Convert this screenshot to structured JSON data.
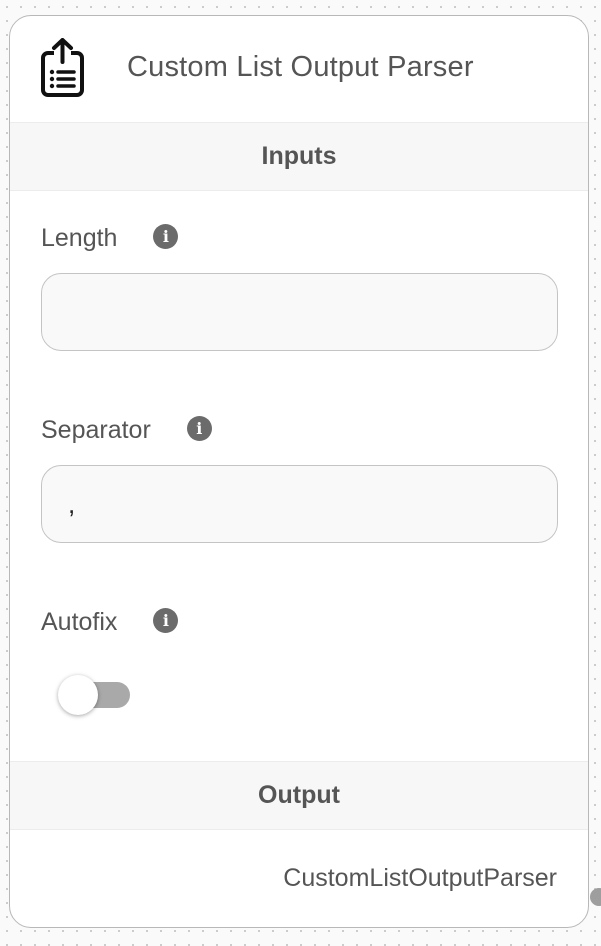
{
  "node": {
    "title": "Custom List Output Parser",
    "icon": "file-upload-list-icon"
  },
  "sections": {
    "inputs_label": "Inputs",
    "output_label": "Output"
  },
  "fields": {
    "length": {
      "label": "Length",
      "value": "",
      "placeholder": ""
    },
    "separator": {
      "label": "Separator",
      "value": ","
    },
    "autofix": {
      "label": "Autofix",
      "enabled": false
    }
  },
  "output": {
    "name": "CustomListOutputParser"
  },
  "colors": {
    "text": "#555555",
    "section_bg": "#f7f7f7",
    "card_border": "#b8b8b8",
    "info_icon": "#6b6b6b",
    "toggle_track_off": "#a9a9a9",
    "handle": "#9e9e9e"
  }
}
